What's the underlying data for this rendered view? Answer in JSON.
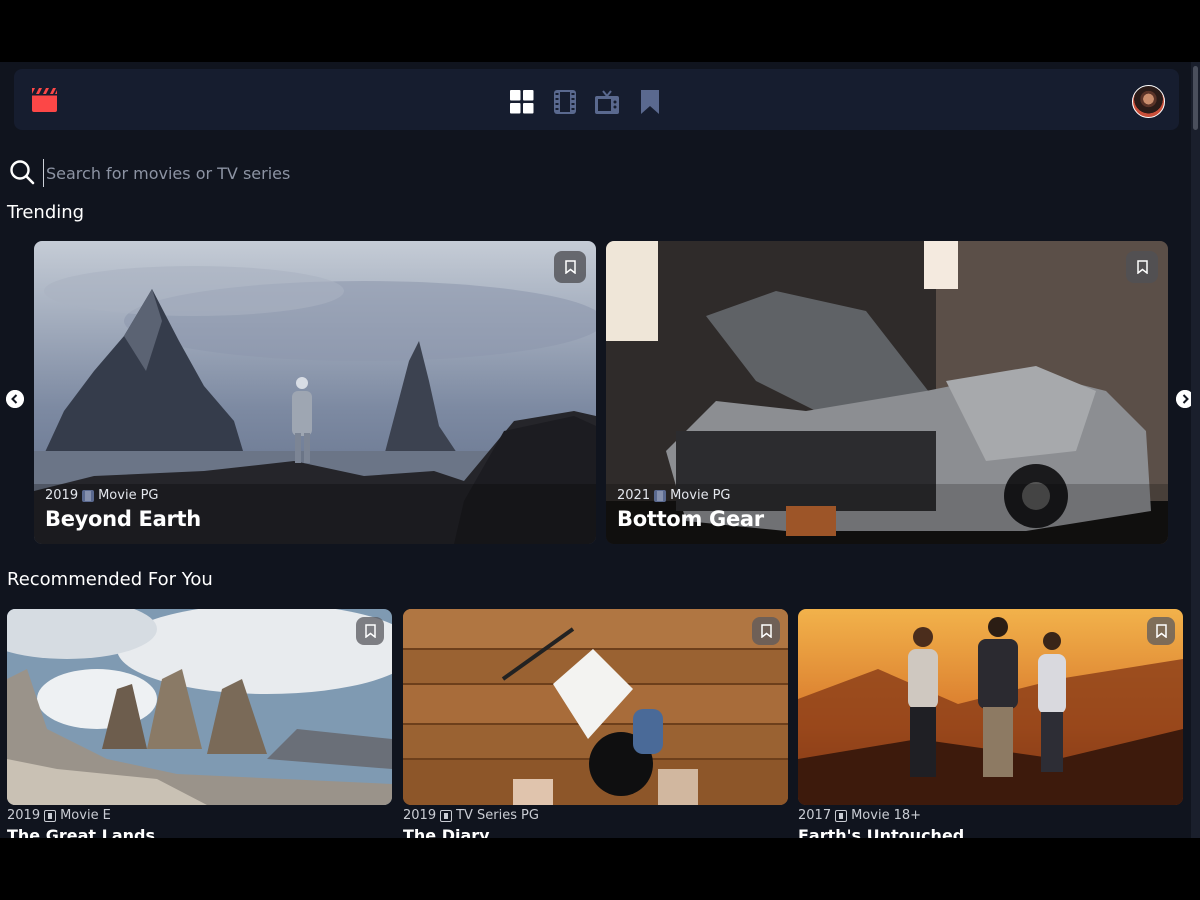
{
  "search": {
    "placeholder": "Search for movies or TV series"
  },
  "nav": {
    "icons": [
      "app-logo-icon",
      "grid-icon",
      "film-icon",
      "tv-icon",
      "bookmark-icon"
    ],
    "accent": "#fc4747",
    "bg": "#161d2f"
  },
  "sections": {
    "trending": "Trending",
    "recommended": "Recommended For You"
  },
  "trending": [
    {
      "year": "2019",
      "type": "Movie",
      "rating": "PG",
      "title": "Beyond Earth"
    },
    {
      "year": "2021",
      "type": "Movie",
      "rating": "PG",
      "title": "Bottom Gear"
    }
  ],
  "recommended": [
    {
      "year": "2019",
      "type": "Movie",
      "rating": "E",
      "title": "The Great Lands"
    },
    {
      "year": "2019",
      "type": "TV Series",
      "rating": "PG",
      "title": "The Diary"
    },
    {
      "year": "2017",
      "type": "Movie",
      "rating": "18+",
      "title": "Earth's Untouched"
    }
  ],
  "colors": {
    "page_bg": "#10141e",
    "muted_text": "#8c93a3"
  }
}
